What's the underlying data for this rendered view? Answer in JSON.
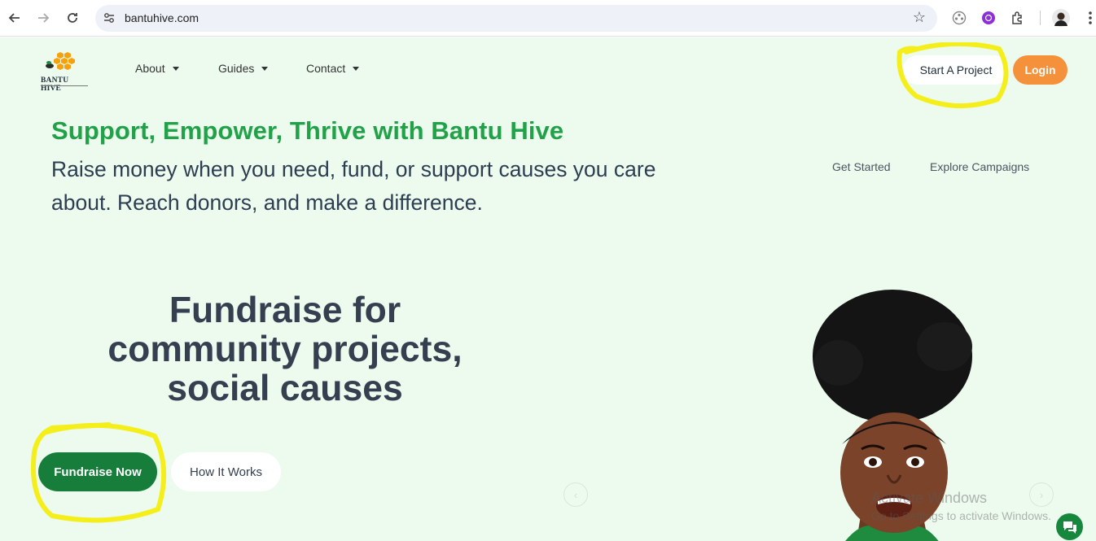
{
  "browser": {
    "url": "bantuhive.com",
    "icons": [
      "back-arrow-icon",
      "forward-arrow-icon",
      "reload-icon",
      "site-settings-icon",
      "bookmark-star-icon",
      "extension-icon",
      "profile-icon",
      "kebab-menu-icon"
    ]
  },
  "header": {
    "logo_text": "BANTU HIVE",
    "menu": [
      {
        "label": "About"
      },
      {
        "label": "Guides"
      },
      {
        "label": "Contact"
      }
    ],
    "start_project_label": "Start A Project",
    "login_label": "Login"
  },
  "intro": {
    "headline": "Support, Empower, Thrive with Bantu Hive",
    "subline": "Raise money when you need, fund, or support causes you care about. Reach donors, and make a difference.",
    "get_started_label": "Get Started",
    "explore_label": "Explore Campaigns"
  },
  "hero": {
    "title_line1": "Fundraise for",
    "title_line2": "community projects,",
    "title_line3": "social causes",
    "fundraise_label": "Fundraise Now",
    "how_label": "How It Works"
  },
  "overlay": {
    "watermark_title": "Activate Windows",
    "watermark_sub": "Go to Settings to activate Windows."
  },
  "colors": {
    "page_bg": "#edfbef",
    "brand_green": "#21a249",
    "button_green": "#177d3b",
    "login_orange": "#f5903b",
    "highlight_yellow": "#f4ef1a"
  }
}
